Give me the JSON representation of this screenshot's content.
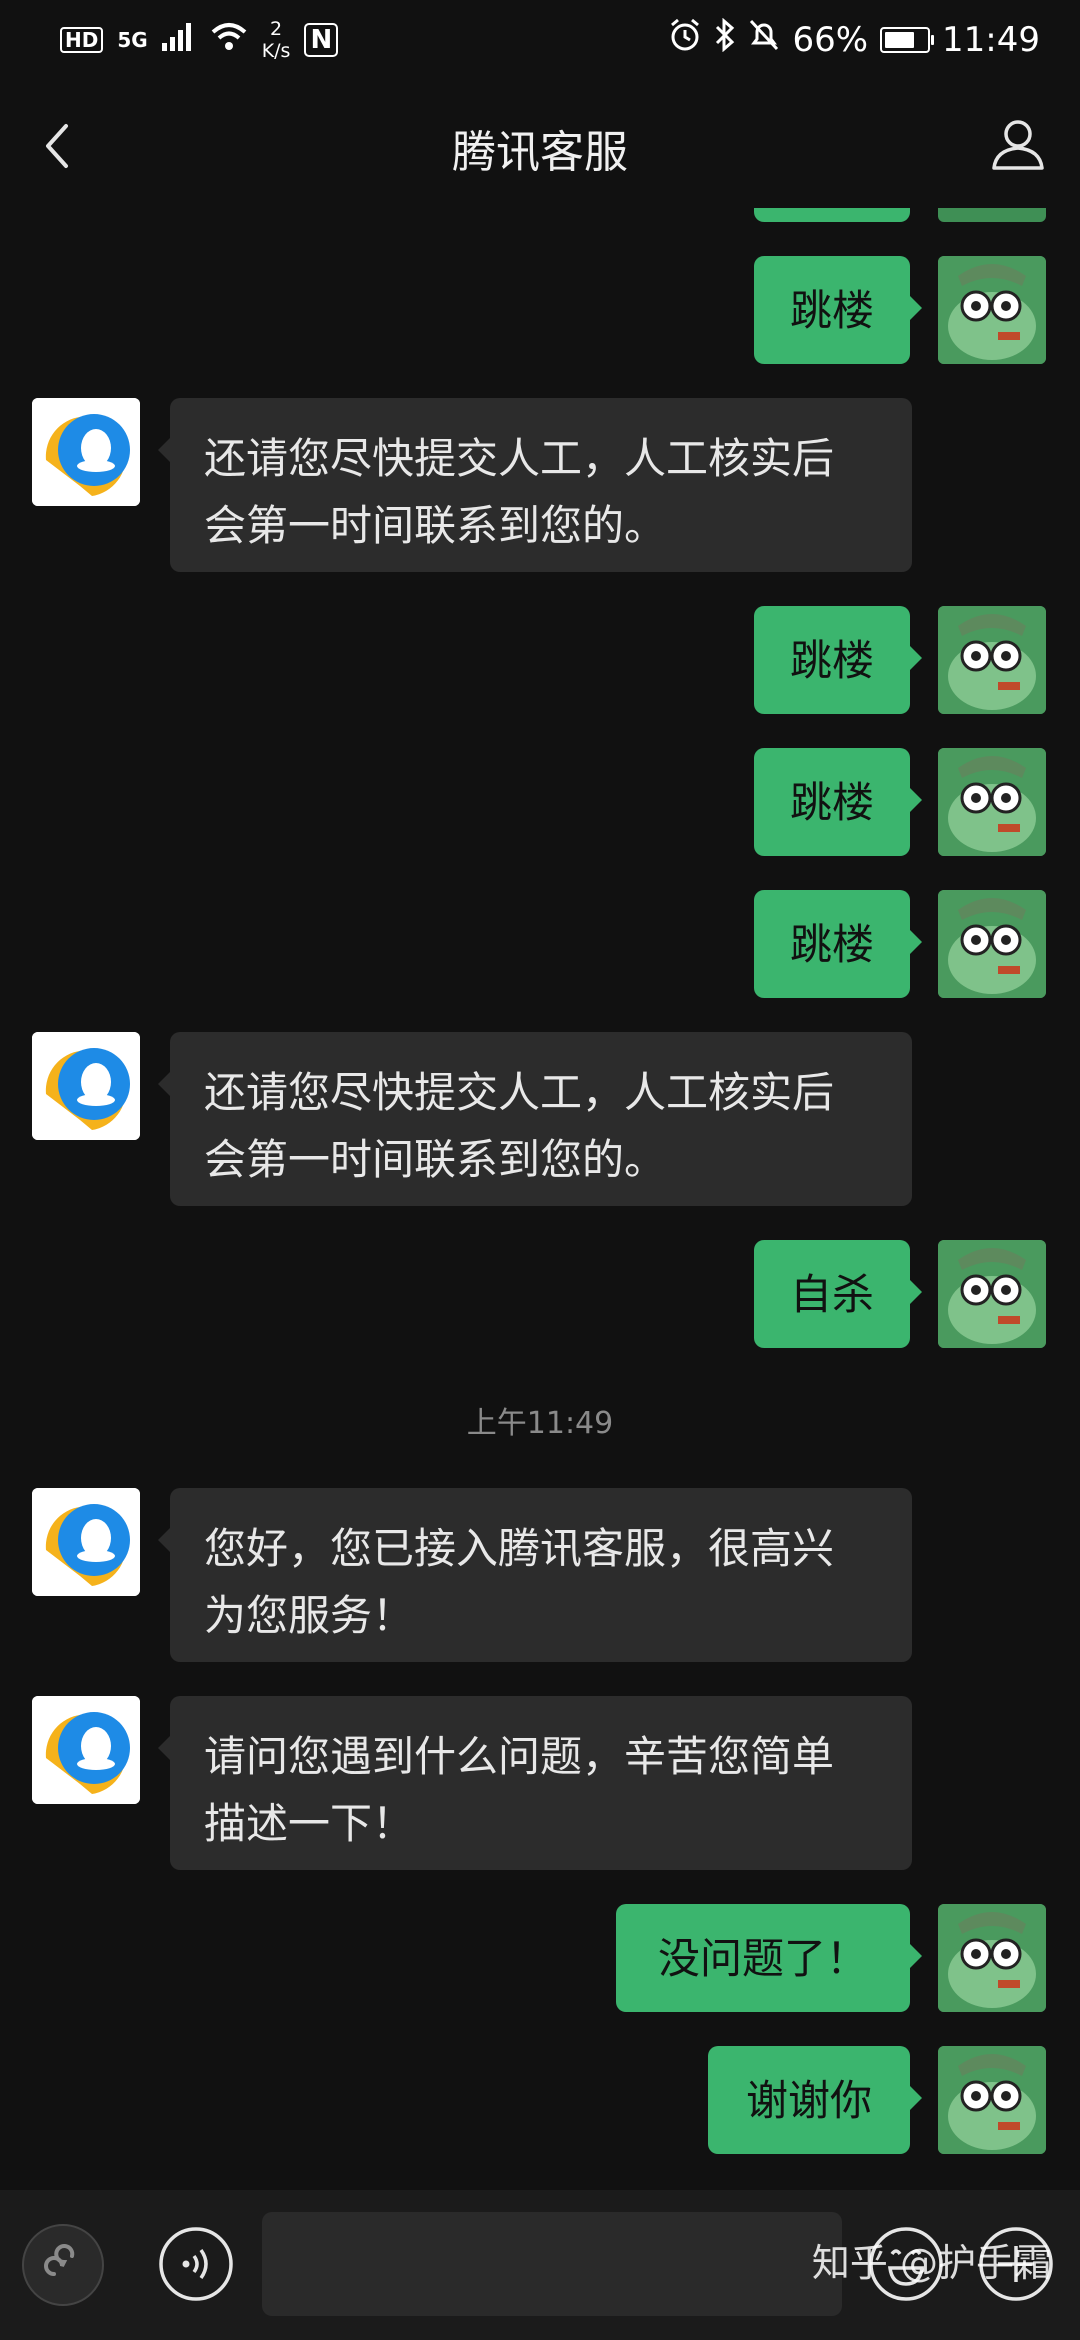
{
  "status_bar": {
    "hd": "HD",
    "network": "5G",
    "speed_value": "2",
    "speed_unit": "K/s",
    "nfc": "N",
    "battery": "66%",
    "time": "11:49"
  },
  "header": {
    "title": "腾讯客服",
    "back_icon": "chevron-left-icon",
    "profile_icon": "person-icon"
  },
  "messages": [
    {
      "side": "in",
      "lines": [
        "还请您尽快提交人工，人工核实后",
        "会第一时间联系到您的。"
      ]
    },
    {
      "side": "out",
      "text": "跳楼"
    },
    {
      "side": "out",
      "text": "跳楼"
    },
    {
      "side": "out",
      "text": "跳楼"
    },
    {
      "side": "out",
      "text": "跳楼"
    },
    {
      "side": "in",
      "lines": [
        "还请您尽快提交人工，人工核实后",
        "会第一时间联系到您的。"
      ]
    },
    {
      "side": "out",
      "text": "自杀"
    },
    {
      "side": "in",
      "lines": [
        "您好，您已接入腾讯客服，很高兴",
        "为您服务！"
      ]
    },
    {
      "side": "in",
      "lines": [
        "请问您遇到什么问题，辛苦您简单",
        "描述一下！"
      ]
    },
    {
      "side": "out",
      "text": "没问题了！"
    },
    {
      "side": "out",
      "text": "谢谢你"
    }
  ],
  "timestamp": "上午11:49",
  "input": {
    "placeholder": "",
    "value": ""
  },
  "bottom_icons": [
    "mini-program-icon",
    "voice-icon",
    "emoji-icon",
    "add-icon"
  ],
  "watermark": "知乎 @护手霜",
  "colors": {
    "background": "#111111",
    "outgoing_bubble": "#3bb56e",
    "incoming_bubble": "#2c2c2c"
  }
}
